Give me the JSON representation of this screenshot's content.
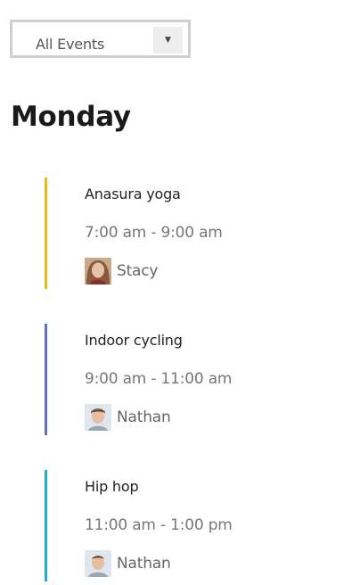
{
  "filter": {
    "selected": "All Events",
    "dropdown_icon": "triangle-down-icon"
  },
  "day": {
    "title": "Monday"
  },
  "events": [
    {
      "title": "Anasura yoga",
      "time": "7:00 am - 9:00 am",
      "host": "Stacy",
      "color": "#e8b718",
      "avatar_icon": "stacy-avatar"
    },
    {
      "title": "Indoor cycling",
      "time": "9:00 am - 11:00 am",
      "host": "Nathan",
      "color": "#5b73c7",
      "avatar_icon": "nathan-avatar"
    },
    {
      "title": "Hip hop",
      "time": "11:00 am - 1:00 pm",
      "host": "Nathan",
      "color": "#1fb2c0",
      "avatar_icon": "nathan-avatar"
    }
  ]
}
